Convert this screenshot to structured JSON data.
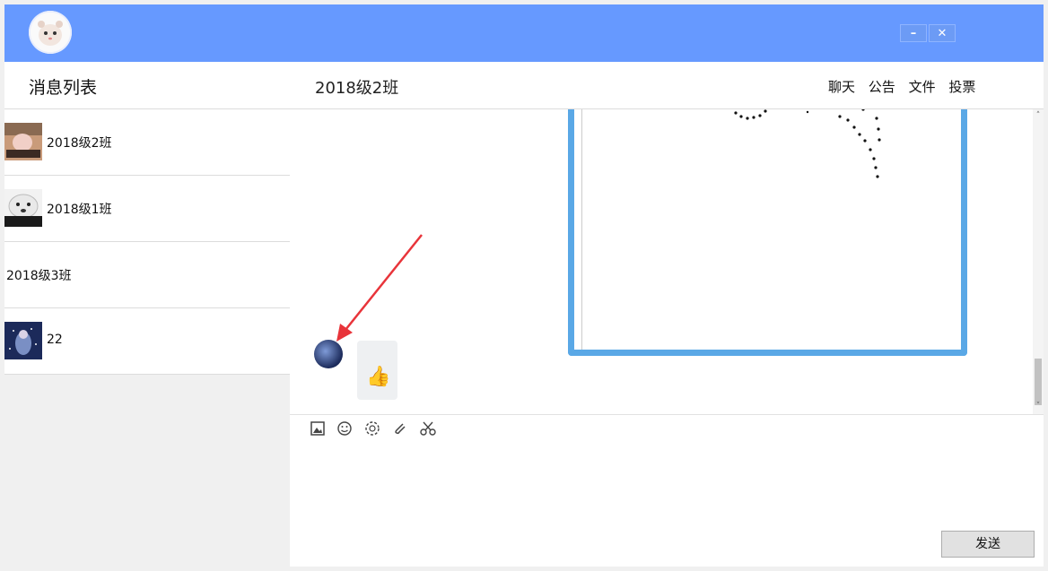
{
  "sidebar": {
    "title": "消息列表",
    "items": [
      {
        "label": "2018级2班",
        "has_avatar": true
      },
      {
        "label": "2018级1班",
        "has_avatar": true
      },
      {
        "label": "2018级3班",
        "has_avatar": false
      },
      {
        "label": "22",
        "has_avatar": true
      }
    ]
  },
  "chat": {
    "title": "2018级2班",
    "tabs": [
      "聊天",
      "公告",
      "文件",
      "投票"
    ]
  },
  "toolbar": {
    "icons": [
      "image-icon",
      "emoji-icon",
      "screenshot-icon",
      "attachment-icon",
      "scissors-icon"
    ]
  },
  "window": {
    "minimize_label": "–",
    "close_label": "✕"
  },
  "send_label": "发送",
  "colors": {
    "titlebar": "#6699ff",
    "image_frame": "#5aa8e6",
    "arrow": "#e8343a"
  }
}
